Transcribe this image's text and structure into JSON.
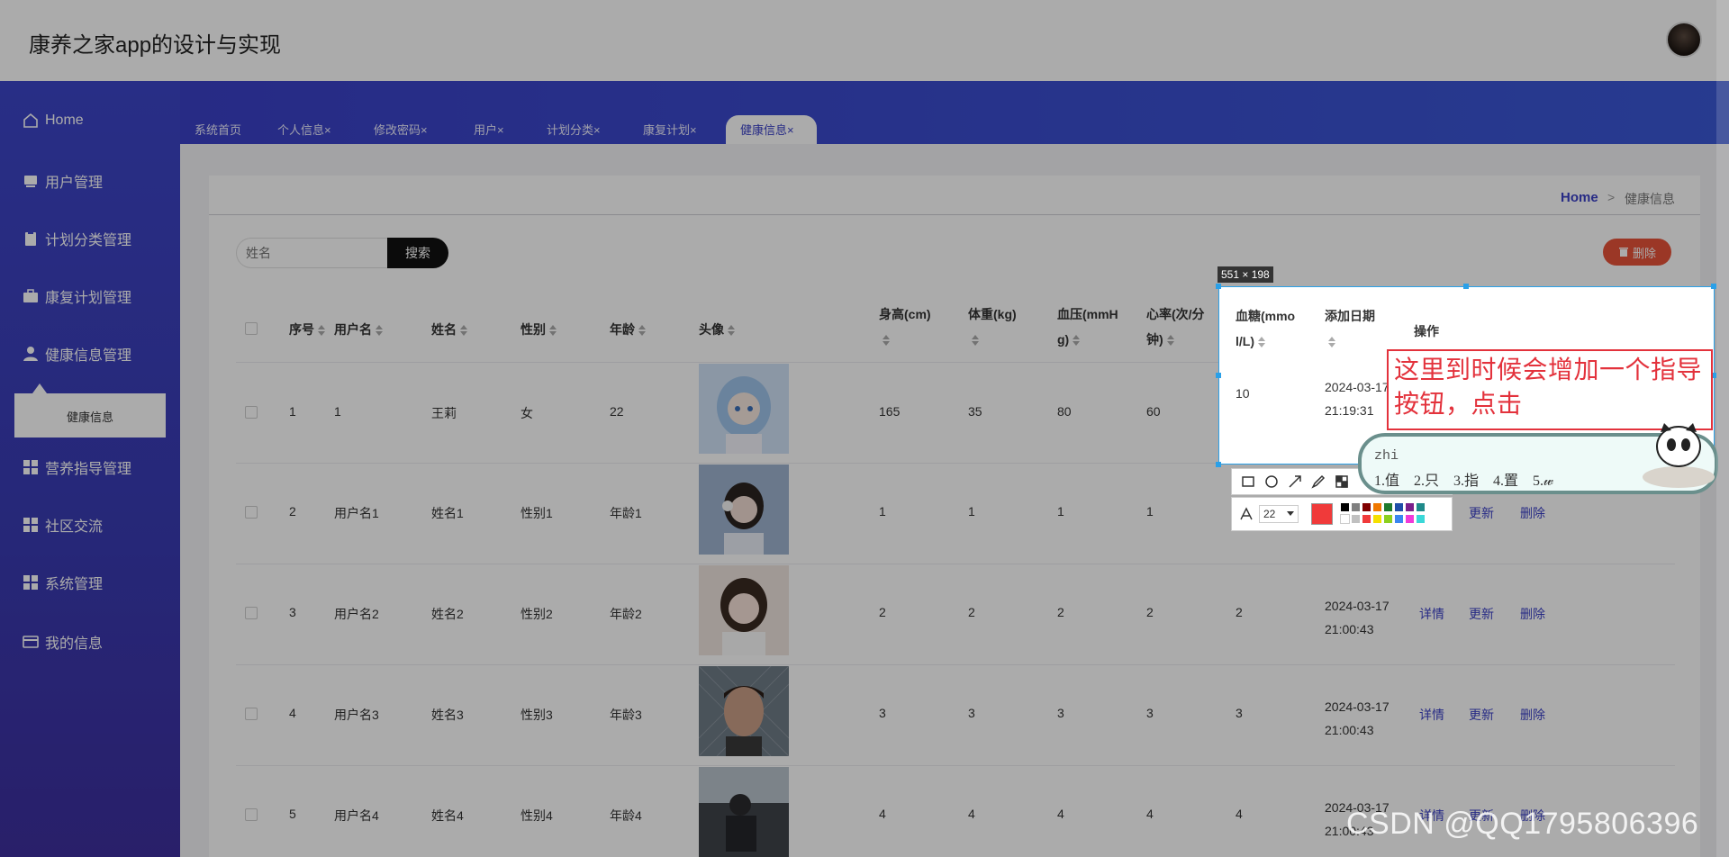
{
  "app": {
    "title": "康养之家app的设计与实现"
  },
  "sidebar": {
    "items": [
      {
        "label": "Home",
        "icon": "home-icon"
      },
      {
        "label": "用户管理",
        "icon": "user-card-icon"
      },
      {
        "label": "计划分类管理",
        "icon": "clipboard-icon"
      },
      {
        "label": "康复计划管理",
        "icon": "briefcase-icon"
      },
      {
        "label": "健康信息管理",
        "icon": "person-icon"
      },
      {
        "label": "营养指导管理",
        "icon": "grid-icon"
      },
      {
        "label": "社区交流",
        "icon": "grid-icon"
      },
      {
        "label": "系统管理",
        "icon": "grid-icon"
      },
      {
        "label": "我的信息",
        "icon": "id-card-icon"
      }
    ],
    "submenu_label": "健康信息"
  },
  "tabs": [
    {
      "label": "系统首页",
      "closable": false
    },
    {
      "label": "个人信息",
      "closable": true
    },
    {
      "label": "修改密码",
      "closable": true
    },
    {
      "label": "用户",
      "closable": true
    },
    {
      "label": "计划分类",
      "closable": true
    },
    {
      "label": "康复计划",
      "closable": true
    },
    {
      "label": "健康信息",
      "closable": true,
      "active": true
    }
  ],
  "tab_close_glyph": "×",
  "breadcrumb": {
    "home": "Home",
    "separator": ">",
    "current": "健康信息"
  },
  "search": {
    "placeholder": "姓名",
    "button_label": "搜索"
  },
  "delete_button_label": "删除",
  "table": {
    "headers": [
      "序号",
      "用户名",
      "姓名",
      "性别",
      "年龄",
      "头像",
      "身高(cm)",
      "体重(kg)",
      "血压(mmHg)",
      "心率(次/分钟)",
      "血糖(mmol/L)",
      "添加日期",
      "操作"
    ],
    "header_lines": {
      "blood_pressure": [
        "血压(mmH",
        "g)"
      ],
      "heart_rate": [
        "心率(次/分",
        "钟)"
      ],
      "blood_sugar": [
        "血糖(mmo",
        "l/L)"
      ]
    },
    "actions": {
      "detail": "详情",
      "update": "更新",
      "delete": "删除"
    },
    "rows": [
      {
        "index": "1",
        "username": "1",
        "name": "王莉",
        "gender": "女",
        "age": "22",
        "avatar": "anime-girl",
        "height": "165",
        "weight": "35",
        "bp": "80",
        "hr": "60",
        "sugar": "10",
        "date_line1": "2024-03-17",
        "date_line2": "21:19:31"
      },
      {
        "index": "2",
        "username": "用户名1",
        "name": "姓名1",
        "gender": "性别1",
        "age": "年龄1",
        "avatar": "girl-headphones",
        "height": "1",
        "weight": "1",
        "bp": "1",
        "hr": "1",
        "sugar": "",
        "date_line1": "",
        "date_line2": ""
      },
      {
        "index": "3",
        "username": "用户名2",
        "name": "姓名2",
        "gender": "性别2",
        "age": "年龄2",
        "avatar": "girl-portrait",
        "height": "2",
        "weight": "2",
        "bp": "2",
        "hr": "2",
        "sugar": "2",
        "date_line1": "2024-03-17",
        "date_line2": "21:00:43"
      },
      {
        "index": "4",
        "username": "用户名3",
        "name": "姓名3",
        "gender": "性别3",
        "age": "年龄3",
        "avatar": "man-fence",
        "height": "3",
        "weight": "3",
        "bp": "3",
        "hr": "3",
        "sugar": "3",
        "date_line1": "2024-03-17",
        "date_line2": "21:00:43"
      },
      {
        "index": "5",
        "username": "用户名4",
        "name": "姓名4",
        "gender": "性别4",
        "age": "年龄4",
        "avatar": "person-dark",
        "height": "4",
        "weight": "4",
        "bp": "4",
        "hr": "4",
        "sugar": "4",
        "date_line1": "2024-03-17",
        "date_line2": "21:00:43"
      }
    ]
  },
  "screenshot_tool": {
    "selection_size": "551 × 198",
    "annotation_text_line1": "这里到时候会增加一个指导",
    "annotation_text_line2": "按钮，点击",
    "font_size": "22",
    "current_color": "#f03a3a"
  },
  "ime": {
    "input": "zhi",
    "candidates": "1.值 2.只 3.指 4.置 5.𝓌"
  },
  "watermark": "CSDN @QQ1795806396",
  "colors": {
    "brand": "#3b40c7",
    "danger": "#e8533a",
    "annotation": "#e3323c",
    "selection": "#2aa0e8"
  }
}
